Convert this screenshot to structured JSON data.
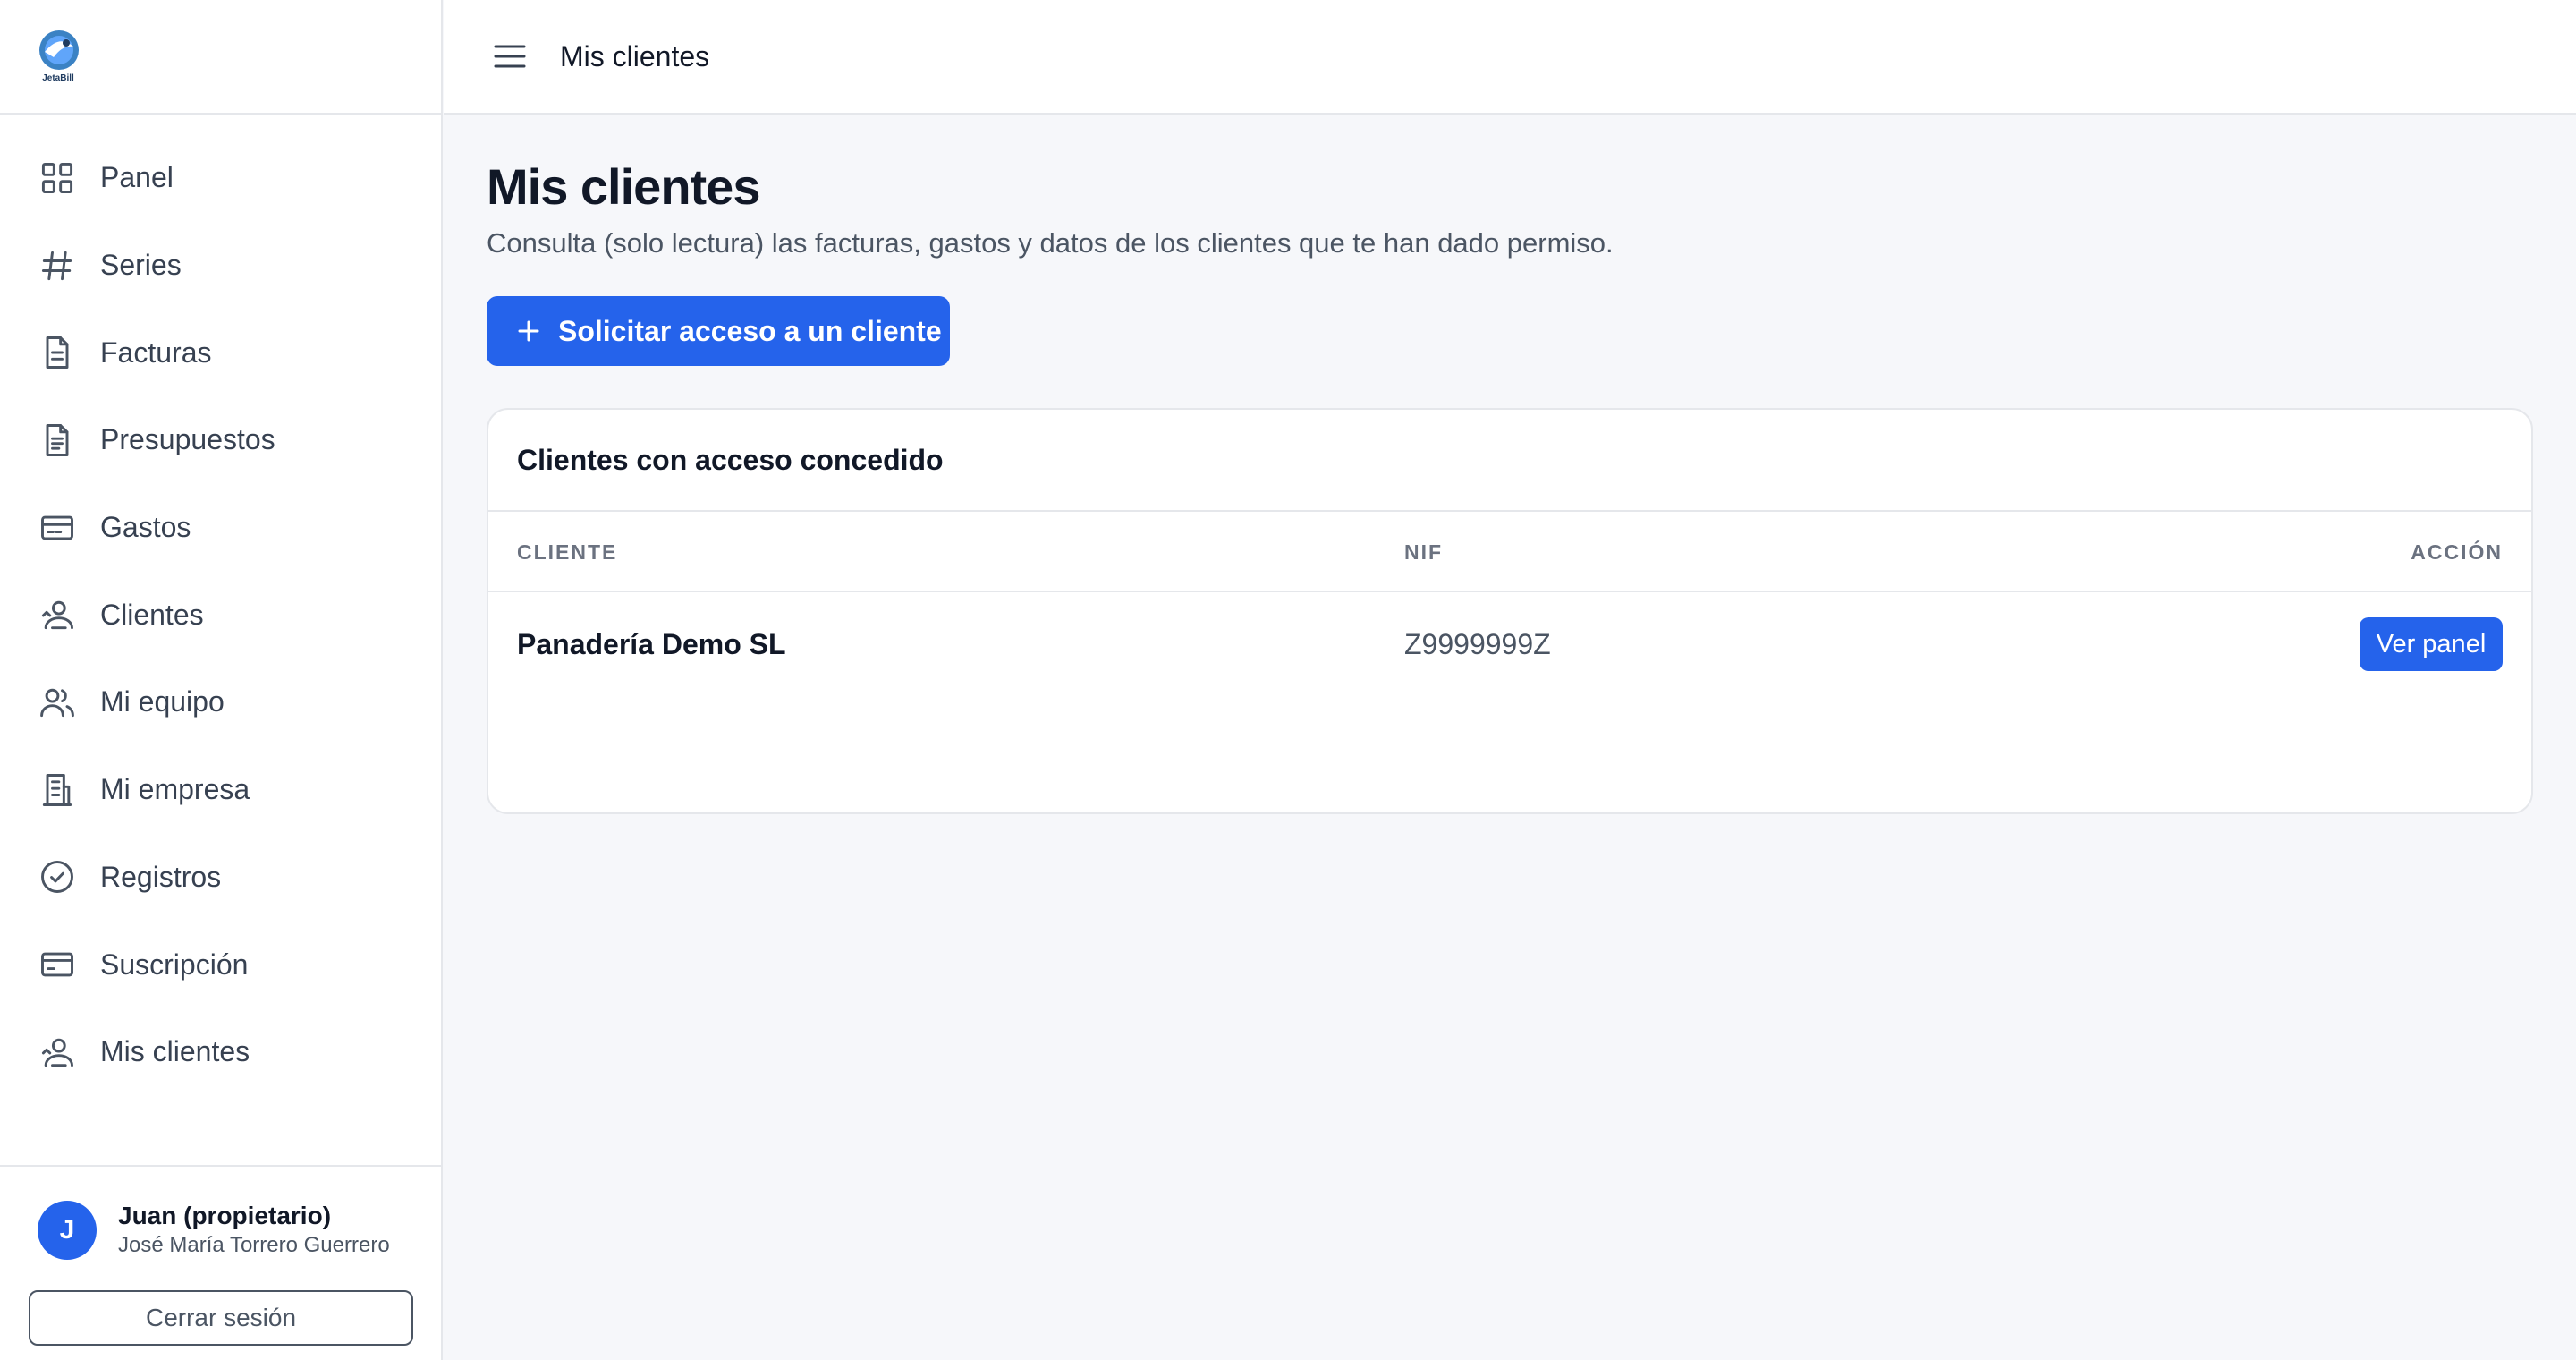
{
  "app": {
    "logo_text": "JetaBill"
  },
  "topbar": {
    "title": "Mis clientes"
  },
  "sidebar": {
    "items": [
      {
        "label": "Panel",
        "icon": "grid-icon"
      },
      {
        "label": "Series",
        "icon": "hash-icon"
      },
      {
        "label": "Facturas",
        "icon": "document-icon"
      },
      {
        "label": "Presupuestos",
        "icon": "document-text-icon"
      },
      {
        "label": "Gastos",
        "icon": "card-icon"
      },
      {
        "label": "Clientes",
        "icon": "client-icon"
      },
      {
        "label": "Mi equipo",
        "icon": "users-icon"
      },
      {
        "label": "Mi empresa",
        "icon": "building-icon"
      },
      {
        "label": "Registros",
        "icon": "check-circle-icon"
      },
      {
        "label": "Suscripción",
        "icon": "credit-card-icon"
      },
      {
        "label": "Mis clientes",
        "icon": "client-icon"
      }
    ]
  },
  "user": {
    "initial": "J",
    "name": "Juan (propietario)",
    "company": "José María Torrero Guerrero",
    "logout_label": "Cerrar sesión"
  },
  "main": {
    "title": "Mis clientes",
    "subtitle": "Consulta (solo lectura) las facturas, gastos y datos de los clientes que te han dado permiso.",
    "request_button": "Solicitar acceso a un cliente",
    "card": {
      "title": "Clientes con acceso concedido",
      "columns": {
        "client": "CLIENTE",
        "nif": "NIF",
        "action": "ACCIÓN"
      },
      "rows": [
        {
          "client": "Panadería Demo SL",
          "nif": "Z9999999Z",
          "action": "Ver panel"
        }
      ]
    }
  },
  "colors": {
    "accent": "#2563eb",
    "background": "#f6f7fa",
    "border": "#e5e7eb"
  }
}
